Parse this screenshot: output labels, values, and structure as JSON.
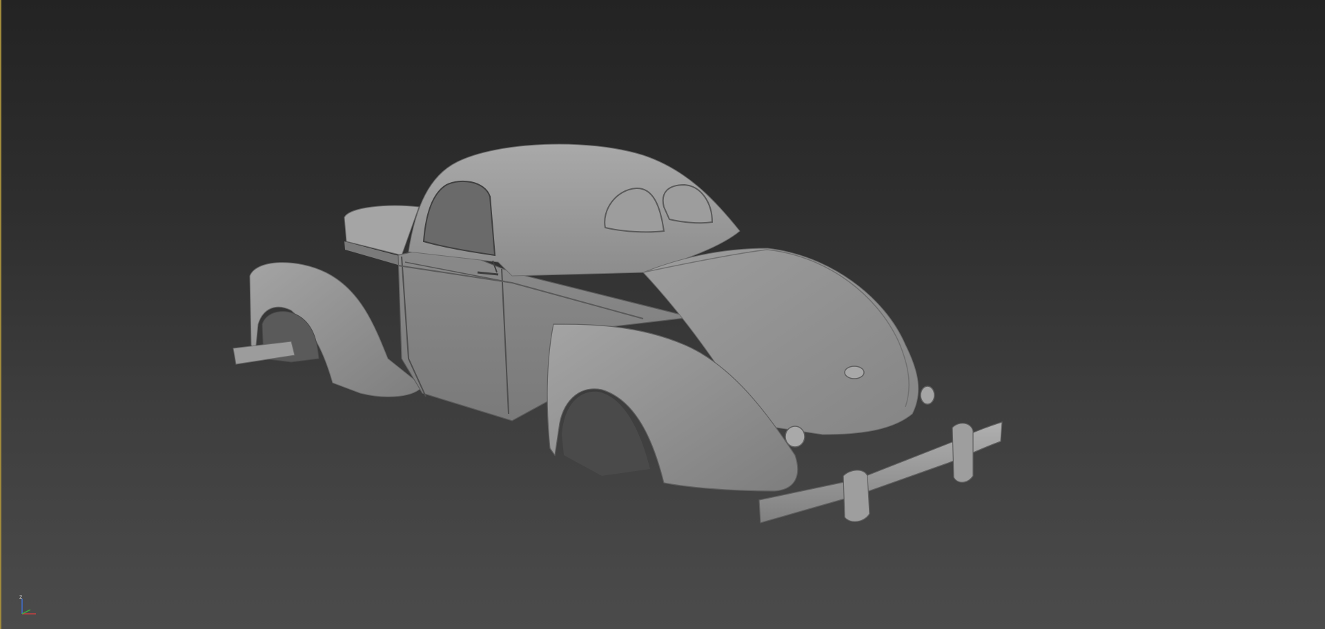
{
  "viewport": {
    "background_top": "#232323",
    "background_bottom": "#4b4b4b",
    "active_border_color": "#a08a3c",
    "model_color": "#9a9a9a"
  },
  "axis_gizmo": {
    "z_label": "z",
    "x_color": "#c84040",
    "y_color": "#40b040",
    "z_color": "#4070d0"
  }
}
